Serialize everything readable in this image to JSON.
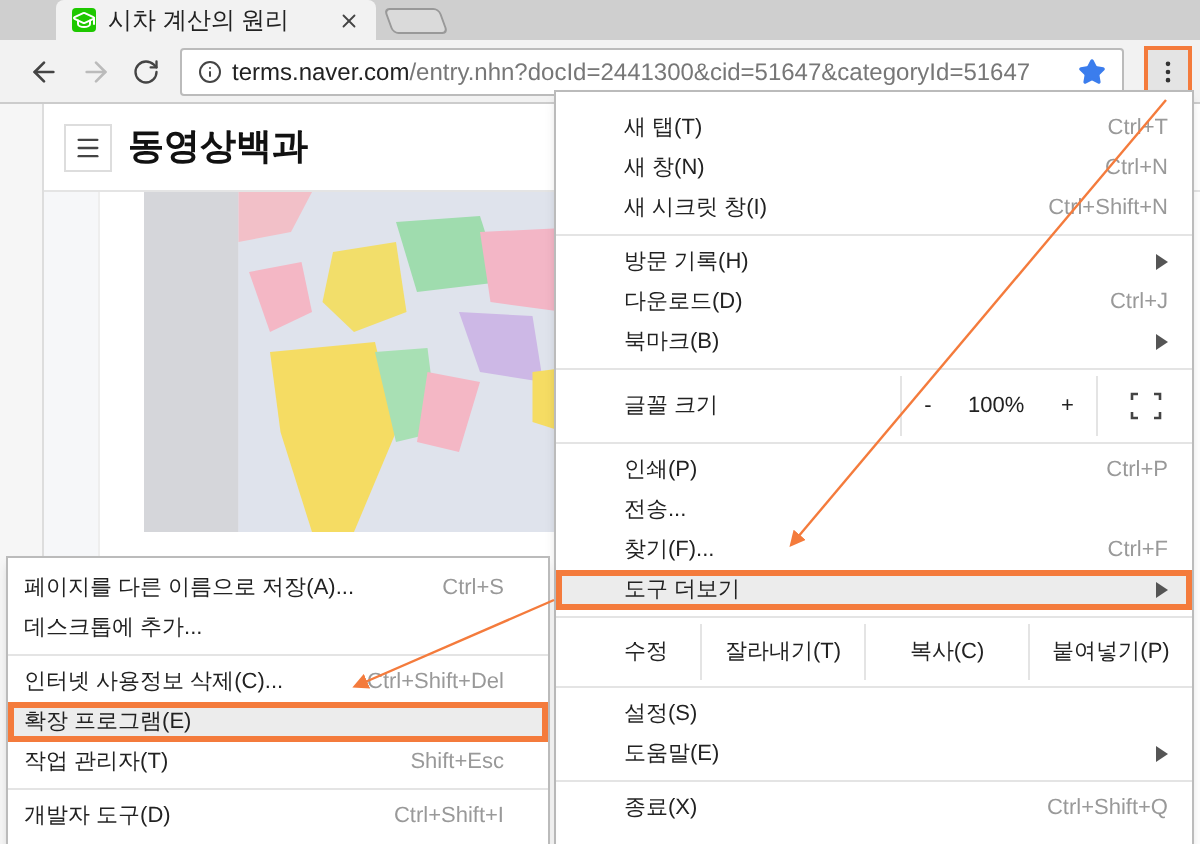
{
  "tab": {
    "title": "시차 계산의 원리",
    "selected": true
  },
  "address_bar": {
    "host": "terms.naver.com",
    "path": "/entry.nhn?docId=2441300&cid=51647&categoryId=51647"
  },
  "page": {
    "title": "동영상백과"
  },
  "menu": {
    "items": [
      {
        "kind": "item",
        "label": "새 탭(T)",
        "shortcut": "Ctrl+T",
        "submenu": false,
        "highlighted": false
      },
      {
        "kind": "item",
        "label": "새 창(N)",
        "shortcut": "Ctrl+N",
        "submenu": false,
        "highlighted": false
      },
      {
        "kind": "item",
        "label": "새 시크릿 창(I)",
        "shortcut": "Ctrl+Shift+N",
        "submenu": false,
        "highlighted": false
      },
      {
        "kind": "divider"
      },
      {
        "kind": "item",
        "label": "방문 기록(H)",
        "submenu": true,
        "highlighted": false
      },
      {
        "kind": "item",
        "label": "다운로드(D)",
        "shortcut": "Ctrl+J",
        "submenu": false,
        "highlighted": false
      },
      {
        "kind": "item",
        "label": "북마크(B)",
        "submenu": true,
        "highlighted": false
      },
      {
        "kind": "divider"
      },
      {
        "kind": "zoom",
        "label": "글꼴 크기",
        "minus": "-",
        "value": "100%",
        "plus": "+"
      },
      {
        "kind": "divider"
      },
      {
        "kind": "item",
        "label": "인쇄(P)",
        "shortcut": "Ctrl+P",
        "submenu": false,
        "highlighted": false
      },
      {
        "kind": "item",
        "label": "전송...",
        "submenu": false,
        "highlighted": false
      },
      {
        "kind": "item",
        "label": "찾기(F)...",
        "shortcut": "Ctrl+F",
        "submenu": false,
        "highlighted": false
      },
      {
        "kind": "item",
        "label": "도구 더보기",
        "submenu": true,
        "highlighted": true
      },
      {
        "kind": "divider"
      },
      {
        "kind": "edit",
        "label": "수정",
        "buttons": [
          "잘라내기(T)",
          "복사(C)",
          "붙여넣기(P)"
        ]
      },
      {
        "kind": "divider"
      },
      {
        "kind": "item",
        "label": "설정(S)",
        "submenu": false,
        "highlighted": false
      },
      {
        "kind": "item",
        "label": "도움말(E)",
        "submenu": true,
        "highlighted": false
      },
      {
        "kind": "divider"
      },
      {
        "kind": "item",
        "label": "종료(X)",
        "shortcut": "Ctrl+Shift+Q",
        "submenu": false,
        "highlighted": false
      }
    ]
  },
  "submenu": {
    "items": [
      {
        "kind": "item",
        "label": "페이지를 다른 이름으로 저장(A)...",
        "shortcut": "Ctrl+S",
        "highlighted": false
      },
      {
        "kind": "item",
        "label": "데스크톱에 추가...",
        "highlighted": false
      },
      {
        "kind": "divider"
      },
      {
        "kind": "item",
        "label": "인터넷 사용정보 삭제(C)...",
        "shortcut": "Ctrl+Shift+Del",
        "highlighted": false
      },
      {
        "kind": "item",
        "label": "확장 프로그램(E)",
        "highlighted": true
      },
      {
        "kind": "item",
        "label": "작업 관리자(T)",
        "shortcut": "Shift+Esc",
        "highlighted": false
      },
      {
        "kind": "divider"
      },
      {
        "kind": "item",
        "label": "개발자 도구(D)",
        "shortcut": "Ctrl+Shift+I",
        "highlighted": false
      }
    ]
  }
}
